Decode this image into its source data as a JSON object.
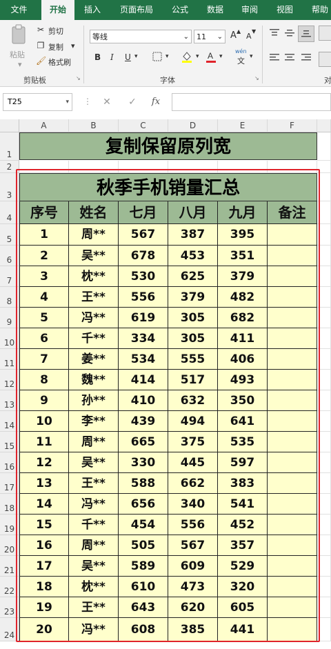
{
  "tabs": [
    "文件",
    "开始",
    "插入",
    "页面布局",
    "公式",
    "数据",
    "审阅",
    "视图",
    "帮助"
  ],
  "active_tab": "开始",
  "clipboard": {
    "paste": "粘贴",
    "cut": "剪切",
    "copy": "复制",
    "format_painter": "格式刷",
    "group": "剪贴板"
  },
  "font": {
    "name": "等线",
    "size": "11",
    "group": "字体",
    "bold": "B",
    "italic": "I",
    "underline": "U",
    "grow": "A",
    "shrink": "A",
    "wen": "wén",
    "wen_char": "文"
  },
  "align": {
    "group": "对"
  },
  "formula_bar": {
    "name_box": "T25",
    "value": "",
    "fx": "fx"
  },
  "columns": [
    "A",
    "B",
    "C",
    "D",
    "E",
    "F"
  ],
  "rows": [
    "1",
    "2",
    "3",
    "4",
    "5",
    "6",
    "7",
    "8",
    "9",
    "10",
    "11",
    "12",
    "13",
    "14",
    "15",
    "16",
    "17",
    "18",
    "19",
    "20",
    "21",
    "22",
    "23",
    "24"
  ],
  "sheet": {
    "title1": "复制保留原列宽",
    "title2": "秋季手机销量汇总",
    "headers": [
      "序号",
      "姓名",
      "七月",
      "八月",
      "九月",
      "备注"
    ],
    "data": [
      [
        "1",
        "周**",
        "567",
        "387",
        "395",
        ""
      ],
      [
        "2",
        "吴**",
        "678",
        "453",
        "351",
        ""
      ],
      [
        "3",
        "枕**",
        "530",
        "625",
        "379",
        ""
      ],
      [
        "4",
        "王**",
        "556",
        "379",
        "482",
        ""
      ],
      [
        "5",
        "冯**",
        "619",
        "305",
        "682",
        ""
      ],
      [
        "6",
        "千**",
        "334",
        "305",
        "411",
        ""
      ],
      [
        "7",
        "姜**",
        "534",
        "555",
        "406",
        ""
      ],
      [
        "8",
        "魏**",
        "414",
        "517",
        "493",
        ""
      ],
      [
        "9",
        "孙**",
        "410",
        "632",
        "350",
        ""
      ],
      [
        "10",
        "李**",
        "439",
        "494",
        "641",
        ""
      ],
      [
        "11",
        "周**",
        "665",
        "375",
        "535",
        ""
      ],
      [
        "12",
        "吴**",
        "330",
        "445",
        "597",
        ""
      ],
      [
        "13",
        "王**",
        "588",
        "662",
        "383",
        ""
      ],
      [
        "14",
        "冯**",
        "656",
        "340",
        "541",
        ""
      ],
      [
        "15",
        "千**",
        "454",
        "556",
        "452",
        ""
      ],
      [
        "16",
        "周**",
        "505",
        "567",
        "357",
        ""
      ],
      [
        "17",
        "吴**",
        "589",
        "609",
        "529",
        ""
      ],
      [
        "18",
        "枕**",
        "610",
        "473",
        "320",
        ""
      ],
      [
        "19",
        "王**",
        "643",
        "620",
        "605",
        ""
      ],
      [
        "20",
        "冯**",
        "608",
        "385",
        "441",
        ""
      ]
    ]
  },
  "colors": {
    "excel_green": "#217346",
    "header_fill": "#9dba94",
    "data_fill": "#ffffcc",
    "selection_red": "#e0232b"
  }
}
